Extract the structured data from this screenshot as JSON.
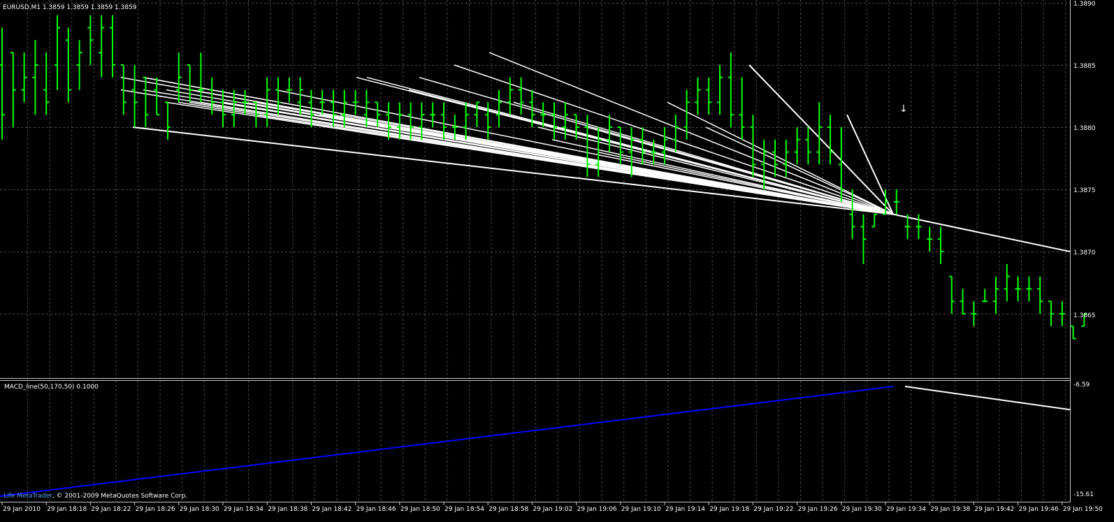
{
  "main_chart": {
    "symbol_info": "EURUSD,M1  1.3859 1.3859 1.3859 1.3859",
    "price_labels": [
      "1.3890",
      "1.3885",
      "1.3880",
      "1.3875",
      "1.3870",
      "1.3865"
    ],
    "arrow_symbol": "↓"
  },
  "indicator": {
    "title": "MACD_line(50,170,50) 0.1000",
    "scale_labels": [
      "-6.59",
      "-15.61"
    ]
  },
  "footer": {
    "brand": "Life MetaTrader",
    "copyright": ", © 2001-2009 MetaQuotes Software Corp."
  },
  "time_labels": [
    "29 Jan 2010",
    "29 Jan 18:18",
    "29 Jan 18:22",
    "29 Jan 18:26",
    "29 Jan 18:30",
    "29 Jan 18:34",
    "29 Jan 18:38",
    "29 Jan 18:42",
    "29 Jan 18:46",
    "29 Jan 18:50",
    "29 Jan 18:54",
    "29 Jan 18:58",
    "29 Jan 19:02",
    "29 Jan 19:06",
    "29 Jan 19:10",
    "29 Jan 19:14",
    "29 Jan 19:18",
    "29 Jan 19:22",
    "29 Jan 19:26",
    "29 Jan 19:30",
    "29 Jan 19:34",
    "29 Jan 19:38",
    "29 Jan 19:42",
    "29 Jan 19:46",
    "29 Jan 19:50"
  ],
  "colors": {
    "background": "#000000",
    "bars": "#00ff00",
    "grid": "#4a4a4a",
    "lines": "#ffffff",
    "macd": "#0000ff",
    "brand": "#5aa0ff"
  },
  "chart_data": [
    {
      "type": "ohlc",
      "symbol": "EURUSD",
      "timeframe": "M1",
      "ylim": [
        1.386,
        1.389
      ],
      "bars": [
        {
          "o": 1.3885,
          "h": 1.3888,
          "l": 1.3879,
          "c": 1.3881
        },
        {
          "o": 1.3886,
          "h": 1.3886,
          "l": 1.388,
          "c": 1.3883
        },
        {
          "o": 1.3883,
          "h": 1.3886,
          "l": 1.3882,
          "c": 1.3884
        },
        {
          "o": 1.3884,
          "h": 1.3887,
          "l": 1.3881,
          "c": 1.3885
        },
        {
          "o": 1.3883,
          "h": 1.3886,
          "l": 1.3881,
          "c": 1.3882
        },
        {
          "o": 1.3885,
          "h": 1.3889,
          "l": 1.3883,
          "c": 1.3888
        },
        {
          "o": 1.3887,
          "h": 1.3888,
          "l": 1.3882,
          "c": 1.3883
        },
        {
          "o": 1.3885,
          "h": 1.3887,
          "l": 1.3883,
          "c": 1.3886
        },
        {
          "o": 1.3888,
          "h": 1.3889,
          "l": 1.3885,
          "c": 1.3887
        },
        {
          "o": 1.3886,
          "h": 1.3889,
          "l": 1.3884,
          "c": 1.3888
        },
        {
          "o": 1.3888,
          "h": 1.3889,
          "l": 1.3884,
          "c": 1.3885
        },
        {
          "o": 1.3885,
          "h": 1.3885,
          "l": 1.3881,
          "c": 1.3882
        },
        {
          "o": 1.3883,
          "h": 1.3885,
          "l": 1.388,
          "c": 1.3882
        },
        {
          "o": 1.3884,
          "h": 1.3884,
          "l": 1.388,
          "c": 1.3881
        },
        {
          "o": 1.3883,
          "h": 1.3884,
          "l": 1.3881,
          "c": 1.3881
        },
        {
          "o": 1.3882,
          "h": 1.3882,
          "l": 1.3879,
          "c": 1.388
        },
        {
          "o": 1.3883,
          "h": 1.3886,
          "l": 1.3882,
          "c": 1.3884
        },
        {
          "o": 1.3885,
          "h": 1.3885,
          "l": 1.3882,
          "c": 1.3883
        },
        {
          "o": 1.3883,
          "h": 1.3886,
          "l": 1.3882,
          "c": 1.3883
        },
        {
          "o": 1.3883,
          "h": 1.3884,
          "l": 1.3881,
          "c": 1.3882
        },
        {
          "o": 1.3882,
          "h": 1.3883,
          "l": 1.388,
          "c": 1.3881
        },
        {
          "o": 1.3881,
          "h": 1.3883,
          "l": 1.388,
          "c": 1.3882
        },
        {
          "o": 1.3882,
          "h": 1.3883,
          "l": 1.3881,
          "c": 1.3882
        },
        {
          "o": 1.3882,
          "h": 1.3882,
          "l": 1.388,
          "c": 1.3881
        },
        {
          "o": 1.3881,
          "h": 1.3884,
          "l": 1.388,
          "c": 1.3883
        },
        {
          "o": 1.3883,
          "h": 1.3884,
          "l": 1.3881,
          "c": 1.3882
        },
        {
          "o": 1.3883,
          "h": 1.3884,
          "l": 1.3882,
          "c": 1.3883
        },
        {
          "o": 1.3882,
          "h": 1.3884,
          "l": 1.3881,
          "c": 1.3883
        },
        {
          "o": 1.3882,
          "h": 1.3883,
          "l": 1.388,
          "c": 1.3881
        },
        {
          "o": 1.3882,
          "h": 1.3883,
          "l": 1.3881,
          "c": 1.3882
        },
        {
          "o": 1.3882,
          "h": 1.3883,
          "l": 1.388,
          "c": 1.3881
        },
        {
          "o": 1.3881,
          "h": 1.3883,
          "l": 1.388,
          "c": 1.3882
        },
        {
          "o": 1.3882,
          "h": 1.3883,
          "l": 1.3881,
          "c": 1.3882
        },
        {
          "o": 1.3881,
          "h": 1.3883,
          "l": 1.388,
          "c": 1.3882
        },
        {
          "o": 1.3882,
          "h": 1.3882,
          "l": 1.388,
          "c": 1.3881
        },
        {
          "o": 1.3881,
          "h": 1.3882,
          "l": 1.3879,
          "c": 1.388
        },
        {
          "o": 1.388,
          "h": 1.3882,
          "l": 1.3879,
          "c": 1.3881
        },
        {
          "o": 1.3881,
          "h": 1.3882,
          "l": 1.3879,
          "c": 1.388
        },
        {
          "o": 1.388,
          "h": 1.3882,
          "l": 1.3879,
          "c": 1.3881
        },
        {
          "o": 1.3881,
          "h": 1.3882,
          "l": 1.388,
          "c": 1.3881
        },
        {
          "o": 1.3881,
          "h": 1.3882,
          "l": 1.3879,
          "c": 1.388
        },
        {
          "o": 1.388,
          "h": 1.3881,
          "l": 1.3879,
          "c": 1.388
        },
        {
          "o": 1.388,
          "h": 1.3882,
          "l": 1.3879,
          "c": 1.3881
        },
        {
          "o": 1.3881,
          "h": 1.3882,
          "l": 1.388,
          "c": 1.3882
        },
        {
          "o": 1.3881,
          "h": 1.3882,
          "l": 1.3879,
          "c": 1.388
        },
        {
          "o": 1.3881,
          "h": 1.3883,
          "l": 1.388,
          "c": 1.3882
        },
        {
          "o": 1.3882,
          "h": 1.3884,
          "l": 1.3881,
          "c": 1.3883
        },
        {
          "o": 1.3883,
          "h": 1.3884,
          "l": 1.3881,
          "c": 1.3882
        },
        {
          "o": 1.3882,
          "h": 1.3883,
          "l": 1.388,
          "c": 1.3881
        },
        {
          "o": 1.3881,
          "h": 1.3882,
          "l": 1.388,
          "c": 1.3881
        },
        {
          "o": 1.3881,
          "h": 1.3882,
          "l": 1.3879,
          "c": 1.388
        },
        {
          "o": 1.388,
          "h": 1.3882,
          "l": 1.3879,
          "c": 1.3881
        },
        {
          "o": 1.3881,
          "h": 1.3881,
          "l": 1.3879,
          "c": 1.388
        },
        {
          "o": 1.388,
          "h": 1.3881,
          "l": 1.3876,
          "c": 1.3877
        },
        {
          "o": 1.3877,
          "h": 1.388,
          "l": 1.3876,
          "c": 1.3879
        },
        {
          "o": 1.3879,
          "h": 1.3881,
          "l": 1.3878,
          "c": 1.388
        },
        {
          "o": 1.388,
          "h": 1.388,
          "l": 1.3877,
          "c": 1.3878
        },
        {
          "o": 1.3878,
          "h": 1.388,
          "l": 1.3876,
          "c": 1.3879
        },
        {
          "o": 1.3879,
          "h": 1.388,
          "l": 1.3877,
          "c": 1.3878
        },
        {
          "o": 1.3878,
          "h": 1.3879,
          "l": 1.3877,
          "c": 1.3878
        },
        {
          "o": 1.3878,
          "h": 1.388,
          "l": 1.3877,
          "c": 1.3879
        },
        {
          "o": 1.3879,
          "h": 1.3881,
          "l": 1.3878,
          "c": 1.388
        },
        {
          "o": 1.388,
          "h": 1.3883,
          "l": 1.3879,
          "c": 1.3882
        },
        {
          "o": 1.3882,
          "h": 1.3884,
          "l": 1.3881,
          "c": 1.3883
        },
        {
          "o": 1.3883,
          "h": 1.3884,
          "l": 1.3881,
          "c": 1.3882
        },
        {
          "o": 1.3882,
          "h": 1.3885,
          "l": 1.3881,
          "c": 1.3884
        },
        {
          "o": 1.3884,
          "h": 1.3886,
          "l": 1.388,
          "c": 1.3881
        },
        {
          "o": 1.3881,
          "h": 1.3884,
          "l": 1.3879,
          "c": 1.388
        },
        {
          "o": 1.388,
          "h": 1.3881,
          "l": 1.3876,
          "c": 1.3877
        },
        {
          "o": 1.3877,
          "h": 1.3879,
          "l": 1.3875,
          "c": 1.3878
        },
        {
          "o": 1.3878,
          "h": 1.3879,
          "l": 1.3876,
          "c": 1.3877
        },
        {
          "o": 1.3877,
          "h": 1.3879,
          "l": 1.3876,
          "c": 1.3878
        },
        {
          "o": 1.3878,
          "h": 1.388,
          "l": 1.3877,
          "c": 1.3879
        },
        {
          "o": 1.3879,
          "h": 1.388,
          "l": 1.3877,
          "c": 1.3878
        },
        {
          "o": 1.3878,
          "h": 1.3882,
          "l": 1.3877,
          "c": 1.388
        },
        {
          "o": 1.388,
          "h": 1.3881,
          "l": 1.3877,
          "c": 1.3878
        },
        {
          "o": 1.3877,
          "h": 1.388,
          "l": 1.3874,
          "c": 1.3875
        },
        {
          "o": 1.3873,
          "h": 1.3875,
          "l": 1.3871,
          "c": 1.3872
        },
        {
          "o": 1.3872,
          "h": 1.3873,
          "l": 1.3869,
          "c": 1.3871
        },
        {
          "o": 1.3872,
          "h": 1.3873,
          "l": 1.3872,
          "c": 1.3873
        },
        {
          "o": 1.3873,
          "h": 1.3875,
          "l": 1.3873,
          "c": 1.3874
        },
        {
          "o": 1.3874,
          "h": 1.3875,
          "l": 1.3873,
          "c": 1.3874
        },
        {
          "o": 1.3872,
          "h": 1.3873,
          "l": 1.3871,
          "c": 1.3872
        },
        {
          "o": 1.3872,
          "h": 1.3873,
          "l": 1.3871,
          "c": 1.3872
        },
        {
          "o": 1.3871,
          "h": 1.3872,
          "l": 1.387,
          "c": 1.3871
        },
        {
          "o": 1.3871,
          "h": 1.3872,
          "l": 1.3869,
          "c": 1.387
        },
        {
          "o": 1.3868,
          "h": 1.3868,
          "l": 1.3865,
          "c": 1.3866
        },
        {
          "o": 1.3866,
          "h": 1.3867,
          "l": 1.3865,
          "c": 1.3865
        },
        {
          "o": 1.3865,
          "h": 1.3866,
          "l": 1.3864,
          "c": 1.3865
        },
        {
          "o": 1.3866,
          "h": 1.3867,
          "l": 1.3866,
          "c": 1.3866
        },
        {
          "o": 1.3866,
          "h": 1.3868,
          "l": 1.3865,
          "c": 1.3867
        },
        {
          "o": 1.3867,
          "h": 1.3869,
          "l": 1.3866,
          "c": 1.3868
        },
        {
          "o": 1.3867,
          "h": 1.3868,
          "l": 1.3866,
          "c": 1.3867
        },
        {
          "o": 1.3867,
          "h": 1.3868,
          "l": 1.3866,
          "c": 1.3867
        },
        {
          "o": 1.3867,
          "h": 1.3868,
          "l": 1.3865,
          "c": 1.3866
        },
        {
          "o": 1.3866,
          "h": 1.3866,
          "l": 1.3864,
          "c": 1.3865
        },
        {
          "o": 1.3865,
          "h": 1.3866,
          "l": 1.3864,
          "c": 1.3865
        },
        {
          "o": 1.3864,
          "h": 1.3864,
          "l": 1.3863,
          "c": 1.3863
        },
        {
          "o": 1.3864,
          "h": 1.3865,
          "l": 1.3864,
          "c": 1.3865
        }
      ],
      "trendlines": [
        {
          "x1": 1.3884,
          "x2": 1.3873
        },
        {
          "x1": 1.3883,
          "x2": 1.3873
        },
        {
          "x1": 1.388,
          "x2": 1.3873
        },
        {
          "x1": 1.3884,
          "x2": 1.3873
        },
        {
          "x1": 1.3884,
          "x2": 1.3873
        },
        {
          "x1": 1.3883,
          "x2": 1.3873
        },
        {
          "x1": 1.3883,
          "x2": 1.3873
        },
        {
          "x1": 1.3882,
          "x2": 1.3873
        },
        {
          "x1": 1.3882,
          "x2": 1.3873
        },
        {
          "x1": 1.3882,
          "x2": 1.3873
        },
        {
          "x1": 1.3883,
          "x2": 1.3873
        },
        {
          "x1": 1.3882,
          "x2": 1.3873
        },
        {
          "x1": 1.3882,
          "x2": 1.3873
        },
        {
          "x1": 1.3882,
          "x2": 1.3873
        },
        {
          "x1": 1.3882,
          "x2": 1.3873
        },
        {
          "x1": 1.3881,
          "x2": 1.3873
        },
        {
          "x1": 1.3882,
          "x2": 1.3873
        },
        {
          "x1": 1.3883,
          "x2": 1.3873
        },
        {
          "x1": 1.3881,
          "x2": 1.3873
        },
        {
          "x1": 1.3881,
          "x2": 1.3873
        },
        {
          "x1": 1.3881,
          "x2": 1.3873
        },
        {
          "x1": 1.3881,
          "x2": 1.3873
        },
        {
          "x1": 1.3884,
          "x2": 1.3873
        },
        {
          "x1": 1.3884,
          "x2": 1.3873
        },
        {
          "x1": 1.3883,
          "x2": 1.3873
        },
        {
          "x1": 1.3884,
          "x2": 1.3873
        },
        {
          "x1": 1.3885,
          "x2": 1.3873
        },
        {
          "x1": 1.3886,
          "x2": 1.3873
        },
        {
          "x1": 1.3882,
          "x2": 1.3873
        },
        {
          "x1": 1.388,
          "x2": 1.3873
        },
        {
          "x1": 1.3879,
          "x2": 1.3873
        },
        {
          "x1": 1.388,
          "x2": 1.3873
        },
        {
          "x1": 1.3878,
          "x2": 1.3873
        },
        {
          "x1": 1.3882,
          "x2": 1.3873
        },
        {
          "x1": 1.388,
          "x2": 1.3873
        }
      ],
      "extended_line": [
        1.3873,
        1.387
      ],
      "macd": {
        "start": -15.61,
        "peak": -6.59,
        "end": -8.5
      }
    }
  ]
}
